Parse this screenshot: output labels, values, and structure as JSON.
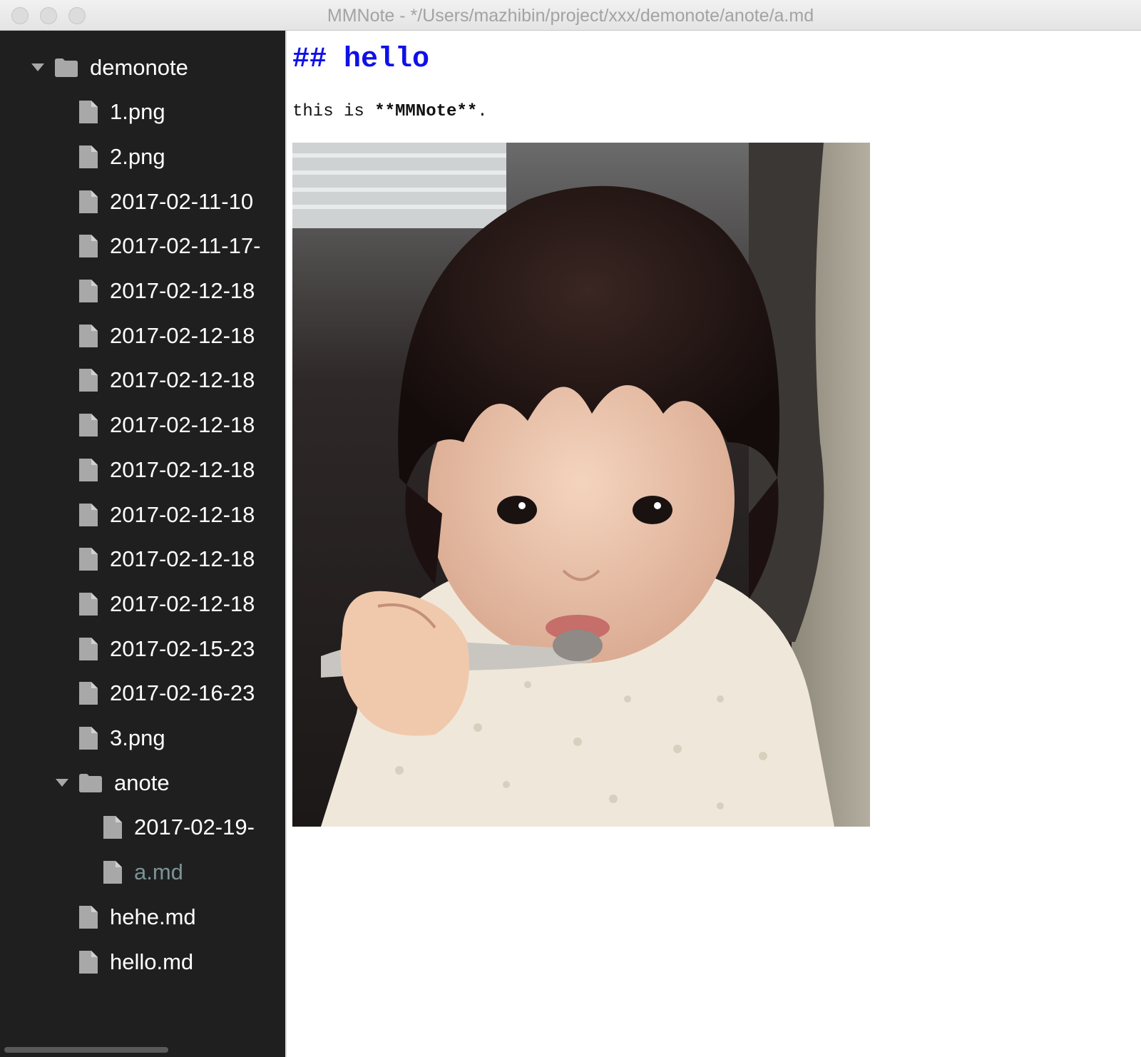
{
  "window": {
    "title": "MMNote - */Users/mazhibin/project/xxx/demonote/anote/a.md"
  },
  "sidebar": {
    "items": [
      {
        "label": "demonote",
        "type": "folder",
        "level": 0,
        "expanded": true
      },
      {
        "label": "1.png",
        "type": "file",
        "level": 1
      },
      {
        "label": "2.png",
        "type": "file",
        "level": 1
      },
      {
        "label": "2017-02-11-10",
        "type": "file",
        "level": 1
      },
      {
        "label": "2017-02-11-17-",
        "type": "file",
        "level": 1
      },
      {
        "label": "2017-02-12-18",
        "type": "file",
        "level": 1
      },
      {
        "label": "2017-02-12-18",
        "type": "file",
        "level": 1
      },
      {
        "label": "2017-02-12-18",
        "type": "file",
        "level": 1
      },
      {
        "label": "2017-02-12-18",
        "type": "file",
        "level": 1
      },
      {
        "label": "2017-02-12-18",
        "type": "file",
        "level": 1
      },
      {
        "label": "2017-02-12-18",
        "type": "file",
        "level": 1
      },
      {
        "label": "2017-02-12-18",
        "type": "file",
        "level": 1
      },
      {
        "label": "2017-02-12-18",
        "type": "file",
        "level": 1
      },
      {
        "label": "2017-02-15-23",
        "type": "file",
        "level": 1
      },
      {
        "label": "2017-02-16-23",
        "type": "file",
        "level": 1
      },
      {
        "label": "3.png",
        "type": "file",
        "level": 1
      },
      {
        "label": "anote",
        "type": "folder",
        "level": 1,
        "expanded": true
      },
      {
        "label": "2017-02-19-",
        "type": "file",
        "level": 2
      },
      {
        "label": "a.md",
        "type": "file",
        "level": 2,
        "selected": true
      },
      {
        "label": "hehe.md",
        "type": "file",
        "level": 1
      },
      {
        "label": "hello.md",
        "type": "file",
        "level": 1
      }
    ]
  },
  "editor": {
    "heading": "## hello",
    "line_prefix": "this is ",
    "line_bold": "**MMNote**",
    "line_suffix": "."
  },
  "colors": {
    "sidebar_bg": "#1f1f1f",
    "heading": "#1010e8",
    "selected_item": "#7c9396"
  }
}
